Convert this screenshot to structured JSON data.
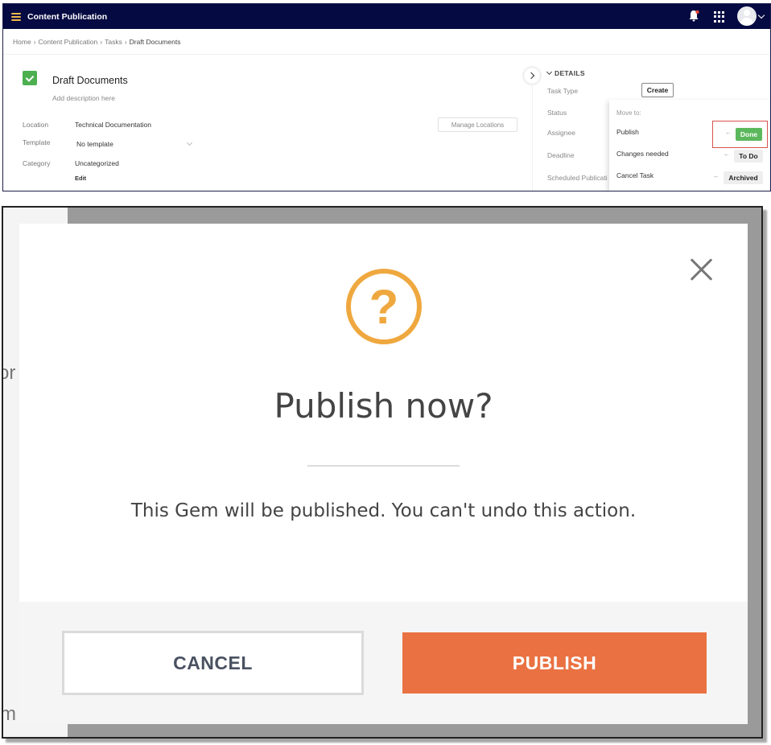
{
  "app": {
    "title": "Content Publication"
  },
  "breadcrumb": [
    "Home",
    "Content Publication",
    "Tasks",
    "Draft Documents"
  ],
  "document": {
    "title": "Draft Documents",
    "description_placeholder": "Add description here",
    "fields": {
      "location_label": "Location",
      "location_value": "Technical Documentation",
      "manage_locations": "Manage Locations",
      "template_label": "Template",
      "template_value": "No template",
      "category_label": "Category",
      "category_value": "Uncategorized",
      "edit": "Edit"
    }
  },
  "details": {
    "heading": "DETAILS",
    "task_type_label": "Task Type",
    "task_type_value": "Create",
    "status_label": "Status",
    "assignee_label": "Assignee",
    "deadline_label": "Deadline",
    "scheduled_label": "Scheduled Publicati"
  },
  "move_to": {
    "heading": "Move to:",
    "options": [
      {
        "label": "Publish",
        "arrow": "←",
        "status": "Done"
      },
      {
        "label": "Changes needed",
        "arrow": "←",
        "status": "To Do"
      },
      {
        "label": "Cancel Task",
        "arrow": "←",
        "status": "Archived"
      }
    ]
  },
  "background_text": {
    "fragment_top": "or",
    "fragment_bottom": "m   y"
  },
  "modal": {
    "icon": "?",
    "title": "Publish now?",
    "message": "This Gem will be published. You can't undo this action.",
    "cancel_label": "CANCEL",
    "publish_label": "PUBLISH"
  },
  "colors": {
    "topbar": "#050a42",
    "done_green": "#5cb85c",
    "highlight_red": "#d9534f",
    "question_orange": "#efa83f",
    "publish_orange": "#ea7242"
  }
}
